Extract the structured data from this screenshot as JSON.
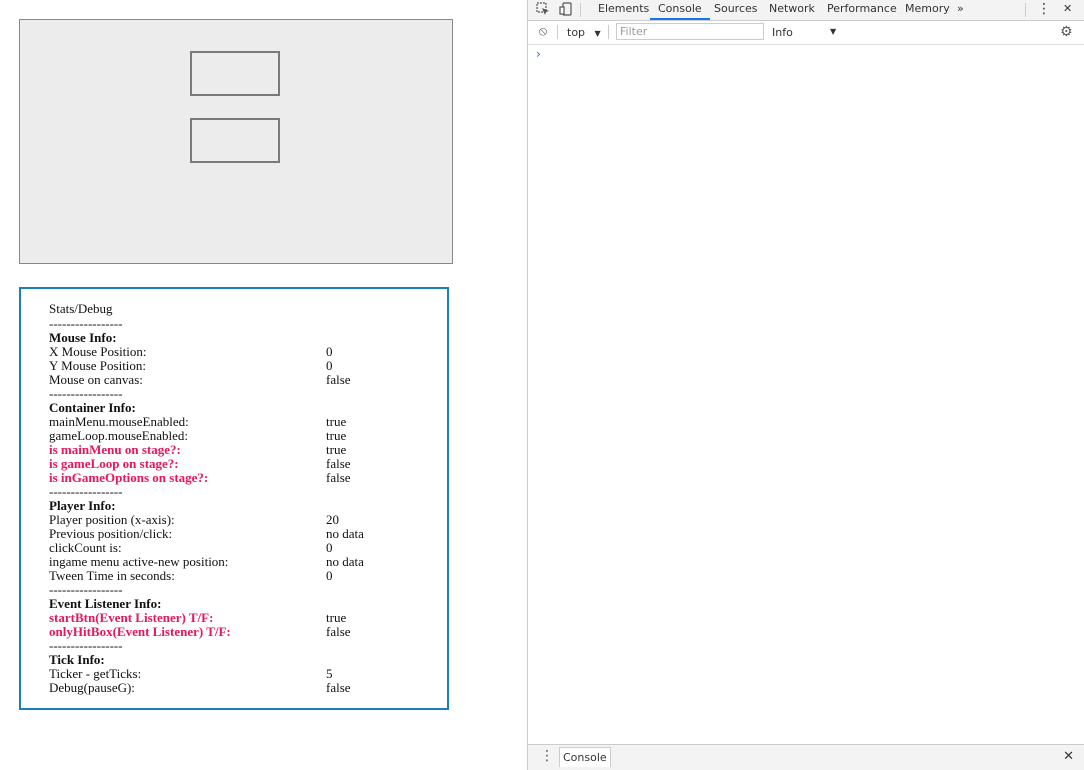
{
  "devtools": {
    "tabs": [
      "Elements",
      "Console",
      "Sources",
      "Network",
      "Performance",
      "Memory"
    ],
    "active_tab": "Console",
    "more_tabs_glyph": "»",
    "kebab_glyph": "⋮",
    "close_glyph": "✕",
    "console": {
      "context_label": "top",
      "context_arrow": "▼",
      "filter_placeholder": "Filter",
      "level_label": "Info",
      "level_arrow": "▼",
      "settings_glyph": "⚙",
      "prompt_glyph": "›",
      "clear_glyph": "⦸"
    },
    "drawer": {
      "kebab_glyph": "⋮",
      "tab_label": "Console",
      "close_glyph": "✕"
    },
    "icons": [
      "inspect-icon",
      "device-icon"
    ]
  },
  "stats": {
    "title": "Stats/Debug",
    "separator": "-----------------",
    "sections": [
      {
        "heading": "Mouse Info:",
        "rows": [
          {
            "label": "X Mouse Position:",
            "value": "0",
            "hl": false
          },
          {
            "label": "Y Mouse Position:",
            "value": "0",
            "hl": false
          },
          {
            "label": "Mouse on canvas:",
            "value": "false",
            "hl": false
          }
        ]
      },
      {
        "heading": "Container Info:",
        "rows": [
          {
            "label": "mainMenu.mouseEnabled:",
            "value": "true",
            "hl": false
          },
          {
            "label": "gameLoop.mouseEnabled:",
            "value": "true",
            "hl": false
          },
          {
            "label": "is mainMenu on stage?:",
            "value": "true",
            "hl": true
          },
          {
            "label": "is gameLoop on stage?:",
            "value": "false",
            "hl": true
          },
          {
            "label": "is inGameOptions on stage?:",
            "value": "false",
            "hl": true
          }
        ]
      },
      {
        "heading": "Player Info:",
        "rows": [
          {
            "label": "Player position (x-axis):",
            "value": "20",
            "hl": false
          },
          {
            "label": "Previous position/click:",
            "value": "no data",
            "hl": false
          },
          {
            "label": "clickCount is:",
            "value": "0",
            "hl": false
          },
          {
            "label": "ingame menu active-new position:",
            "value": "no data",
            "hl": false
          },
          {
            "label": "Tween Time in seconds:",
            "value": "0",
            "hl": false
          }
        ]
      },
      {
        "heading": "Event Listener Info:",
        "rows": [
          {
            "label": "startBtn(Event Listener) T/F:",
            "value": "true",
            "hl": true
          },
          {
            "label": "onlyHitBox(Event Listener) T/F:",
            "value": "false",
            "hl": true
          }
        ]
      },
      {
        "heading": "Tick Info:",
        "rows": [
          {
            "label": "Ticker - getTicks:",
            "value": "5",
            "hl": false
          },
          {
            "label": "Debug(pauseG):",
            "value": "false",
            "hl": false
          }
        ]
      }
    ]
  }
}
